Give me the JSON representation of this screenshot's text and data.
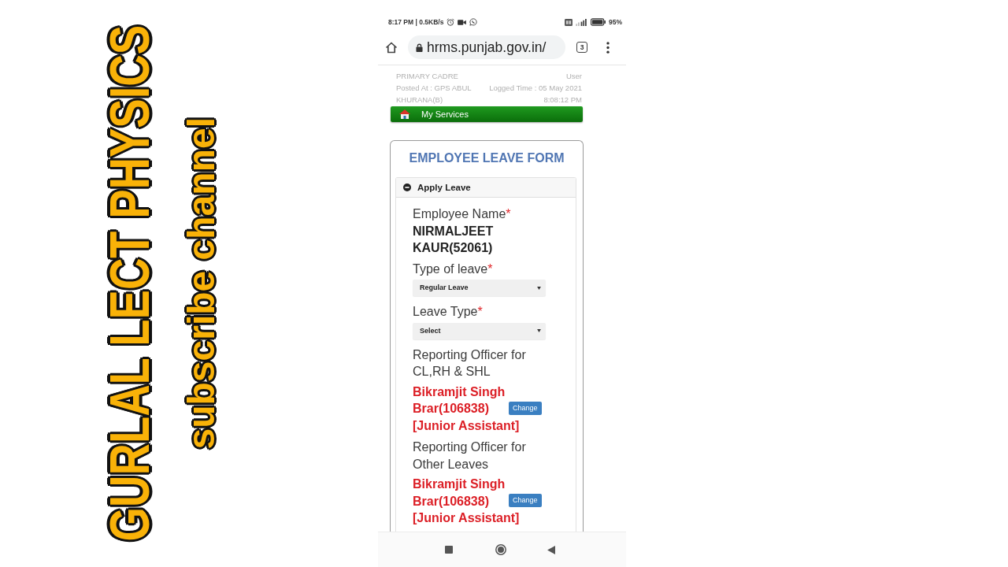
{
  "overlay": {
    "title": "GURLAL LECT PHYSICS",
    "subtitle": "subscribe channel"
  },
  "status_bar": {
    "text": "8:17 PM | 0.5KB/s",
    "battery": "95%"
  },
  "browser": {
    "url": "hrms.punjab.gov.in/",
    "tab_count": "3"
  },
  "user_info": [
    {
      "left": "PRIMARY CADRE",
      "right": "User"
    },
    {
      "left": "Posted At : GPS ABUL",
      "right": "Logged Time : 05 May 2021"
    },
    {
      "left": "KHURANA(B)",
      "right": "8:08:12 PM"
    }
  ],
  "menu_bar": {
    "label": "My Services"
  },
  "form": {
    "title": "EMPLOYEE LEAVE FORM",
    "section": {
      "title": "Apply Leave",
      "expanded": true
    },
    "fields": [
      {
        "kind": "text",
        "label": "Employee Name",
        "required_mark": "*",
        "value": "NIRMALJEET KAUR(52061)"
      },
      {
        "kind": "select",
        "label": "Type of leave",
        "required_mark": "*",
        "value": "Regular Leave"
      },
      {
        "kind": "select",
        "label": "Leave Type",
        "required_mark": "*",
        "value": "Select"
      },
      {
        "kind": "officer",
        "label": "Reporting Officer for CL,RH & SHL",
        "name": "Bikramjit Singh Brar(106838)",
        "action": "Change",
        "designation": "[Junior Assistant]"
      },
      {
        "kind": "officer",
        "label": "Reporting Officer for Other Leaves",
        "name": "Bikramjit Singh Brar(106838)",
        "action": "Change",
        "designation": "[Junior Assistant]"
      }
    ]
  }
}
